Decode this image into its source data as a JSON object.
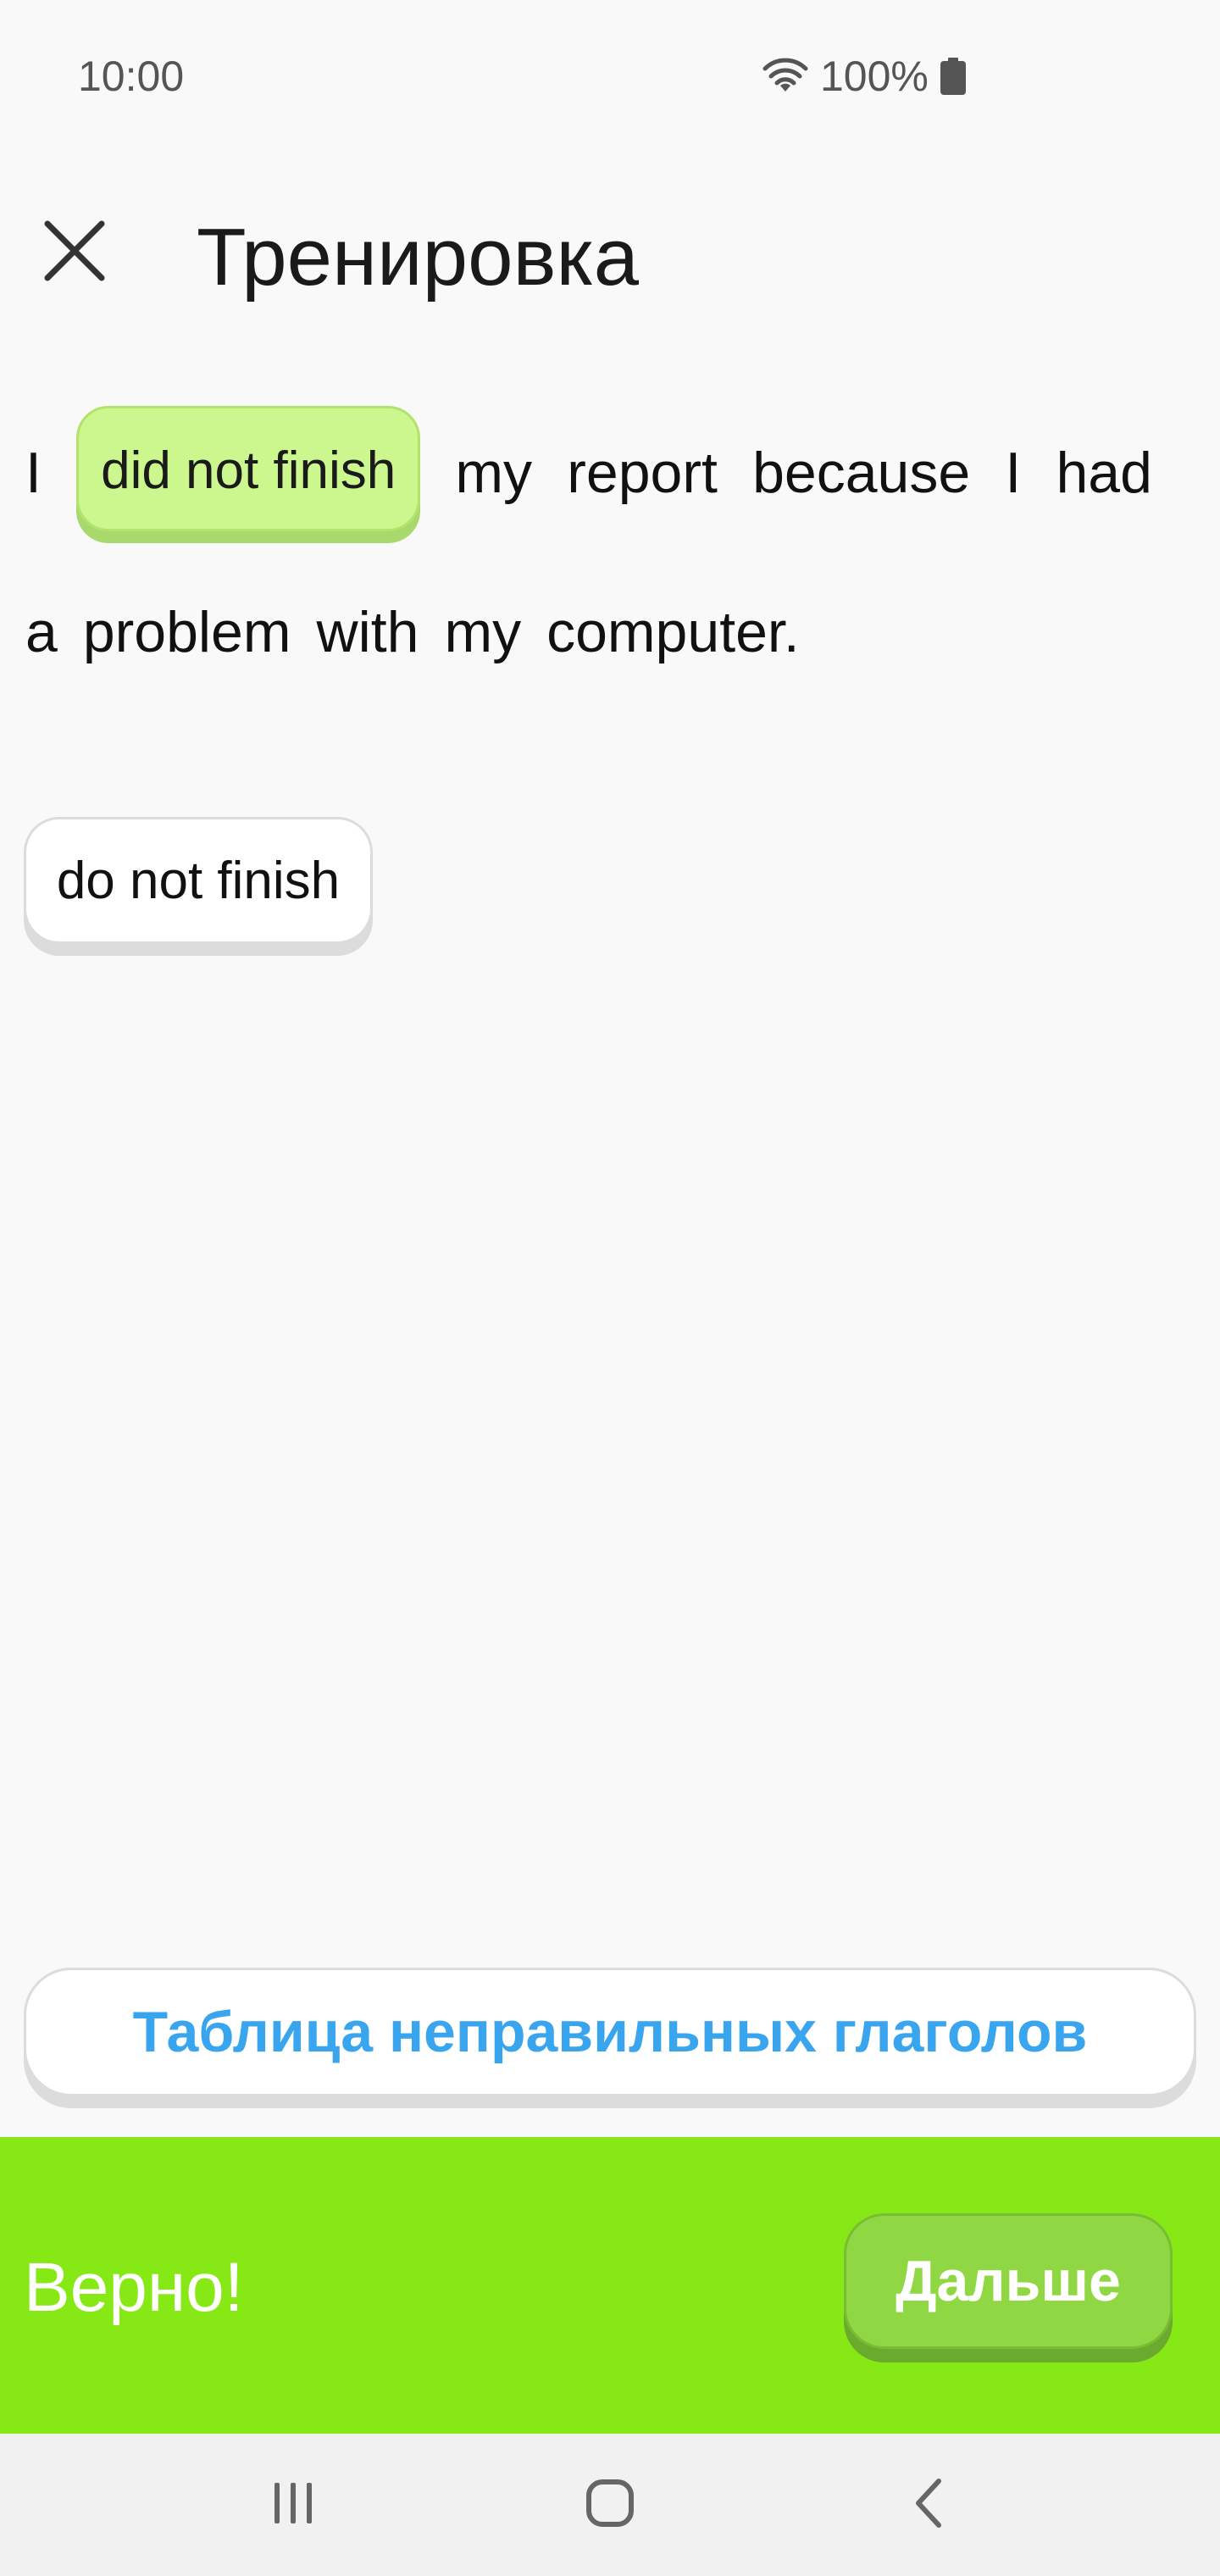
{
  "status_bar": {
    "time": "10:00",
    "battery_percent": "100%",
    "icons": [
      "wifi-icon",
      "battery-icon"
    ]
  },
  "header": {
    "title": "Тренировка",
    "close_icon": "close-icon"
  },
  "exercise": {
    "sentence_words_line1_before": "I",
    "answer": "did not finish",
    "sentence_words_line1_after": [
      "my",
      "report",
      "because",
      "I",
      "had"
    ],
    "sentence_words_line2": [
      "a",
      "problem",
      "with",
      "my",
      "computer."
    ],
    "options": [
      "do not finish"
    ]
  },
  "table_button": {
    "label": "Таблица неправильных глаголов"
  },
  "result": {
    "text": "Верно!",
    "next_label": "Дальше"
  },
  "nav_bar": {
    "icons": [
      "recent-apps-icon",
      "home-icon",
      "back-icon"
    ]
  },
  "colors": {
    "answer_chip": "#ccf78f",
    "result_bar": "#86e815",
    "next_button": "#90d843",
    "table_button_text": "#3aa5ef"
  }
}
